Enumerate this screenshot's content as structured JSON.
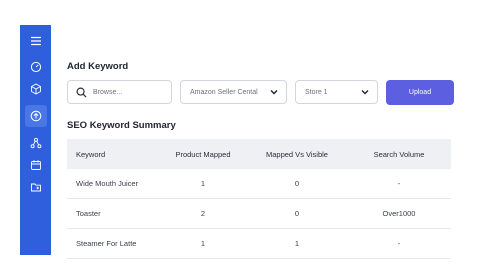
{
  "sidebar": {
    "items": [
      {
        "icon": "hamburger-menu-icon"
      },
      {
        "icon": "dashboard-gauge-icon"
      },
      {
        "icon": "cube-icon"
      },
      {
        "icon": "upload-icon"
      },
      {
        "icon": "network-icon"
      },
      {
        "icon": "calendar-icon"
      },
      {
        "icon": "folder-icon"
      }
    ],
    "accent": "#2f5fdc"
  },
  "add_keyword": {
    "title": "Add Keyword",
    "search_placeholder": "Browse...",
    "channel_value": "Amazon Seller Cental",
    "store_value": "Store 1",
    "upload_label": "Upload",
    "upload_color": "#5b5fe0"
  },
  "summary": {
    "title": "SEO Keyword Summary",
    "columns": [
      "Keyword",
      "Product Mapped",
      "Mapped Vs Visible",
      "Search Volume"
    ],
    "rows": [
      [
        "Wide Mouth Juicer",
        "1",
        "0",
        "-"
      ],
      [
        "Toaster",
        "2",
        "0",
        "Over1000"
      ],
      [
        "Steamer For Latte",
        "1",
        "1",
        "-"
      ]
    ]
  }
}
